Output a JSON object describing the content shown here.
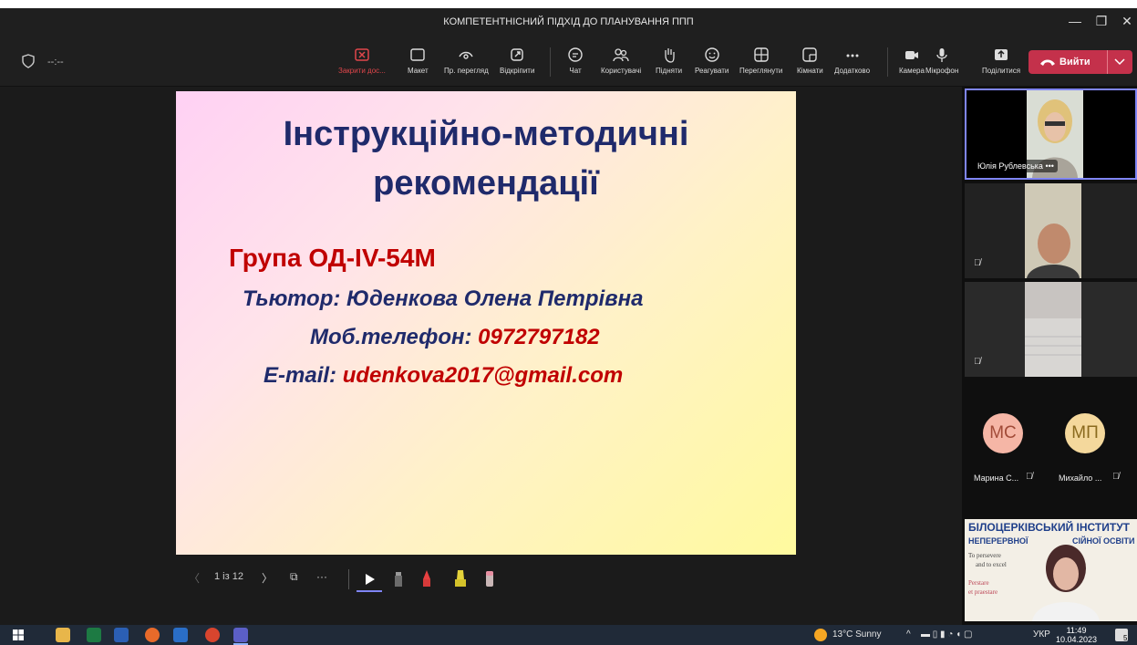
{
  "window": {
    "title": "КОМПЕТЕНТНІСНИЙ ПІДХІД ДО ПЛАНУВАННЯ ППП"
  },
  "meeting": {
    "timer": "--:--"
  },
  "toolbar": {
    "stop_share": "Закрити дос...",
    "layout": "Макет",
    "presenter_view": "Пр. перегляд",
    "pop_out": "Відкріпити",
    "chat": "Чат",
    "people": "Користувачі",
    "raise": "Підняти",
    "react": "Реагувати",
    "view": "Переглянути",
    "rooms": "Кімнати",
    "more": "Додатково",
    "camera": "Камера",
    "mic": "Мікрофон",
    "share": "Поділитися",
    "leave": "Вийти"
  },
  "slide": {
    "title_line1": "Інструкційно-методичні",
    "title_line2": "рекомендації",
    "group": "Група  ОД-IV-54М",
    "tutor": "Тьютор: Юденкова Олена Петрівна",
    "phone_label": "Моб.телефон: ",
    "phone_value": "0972797182",
    "email_label": "E-mail: ",
    "email_value": "udenkova2017@gmail.com"
  },
  "slide_nav": {
    "page": "1 із 12"
  },
  "participants": {
    "p1_name": "Юлія Рублевська",
    "p1_more": "•••",
    "ms_initials": "МС",
    "ms_name": "Марина С...",
    "mp_initials": "МП",
    "mp_name": "Михайло ...",
    "banner_line1": "БІЛОЦЕРКІВСЬКИЙ ІНСТИТУТ",
    "banner_line2a": "НЕПЕРЕРВНОЇ",
    "banner_line2b": "СІЙНОЇ ОСВІТИ",
    "banner_motto1": "To persevere",
    "banner_motto2": "and to excel",
    "banner_motto3": "Perstare",
    "banner_motto4": "et praestare"
  },
  "taskbar": {
    "weather": "13°C  Sunny",
    "lang": "УКР",
    "time": "11:49",
    "date": "10.04.2023",
    "notif_count": "5"
  },
  "colors": {
    "accent": "#7f85f5",
    "leave": "#c4314b",
    "slide_blue": "#1f2a6b",
    "slide_red": "#c00000"
  }
}
